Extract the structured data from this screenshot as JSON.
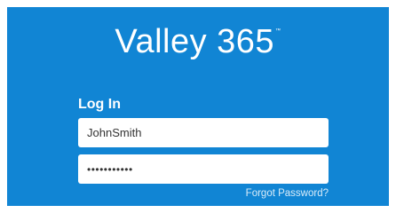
{
  "brand": {
    "name": "Valley 365",
    "trademark": "™"
  },
  "login": {
    "heading": "Log In",
    "username_value": "JohnSmith",
    "password_masked": "•••••••••••",
    "forgot_password_label": "Forgot Password?"
  },
  "colors": {
    "background": "#1185d4",
    "field": "#ffffff",
    "text_on_background": "#ffffff"
  }
}
